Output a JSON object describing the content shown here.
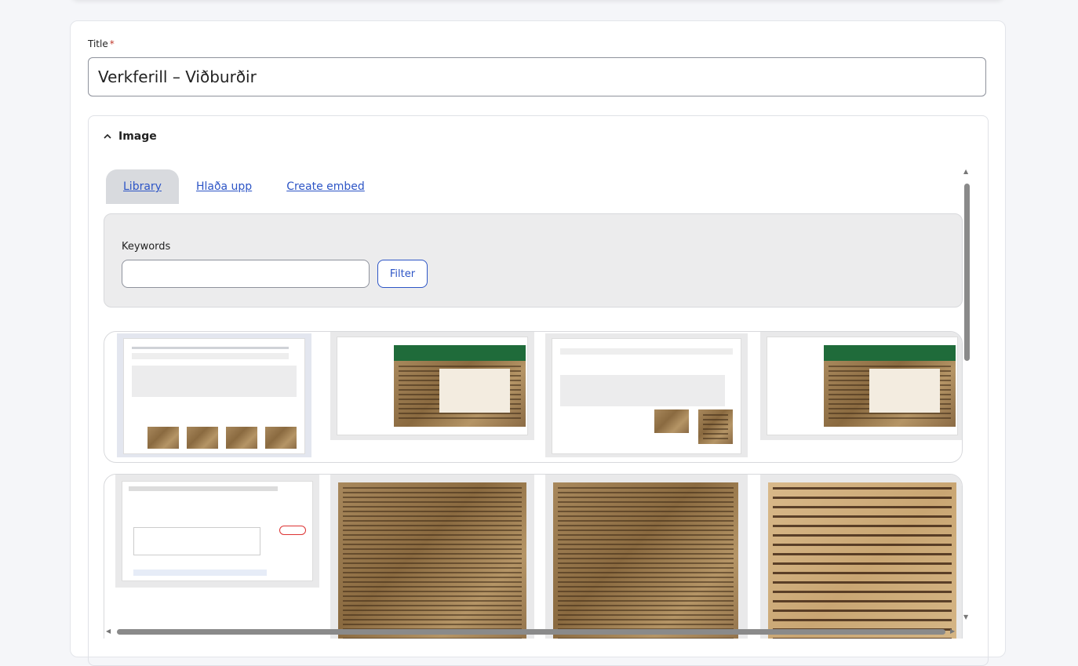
{
  "form": {
    "title_label": "Title",
    "required_marker": "*",
    "title_value": "Verkferill – Viðburðir"
  },
  "image_section": {
    "summary_label": "Image",
    "tabs": [
      {
        "label": "Library",
        "active": true
      },
      {
        "label": "Hlaða upp",
        "active": false
      },
      {
        "label": "Create embed",
        "active": false
      }
    ],
    "filter": {
      "keywords_label": "Keywords",
      "keywords_value": "",
      "filter_button": "Filter"
    }
  },
  "colors": {
    "accent": "#2d55c6",
    "required": "#c0392b",
    "green": "#1f6b3a"
  }
}
